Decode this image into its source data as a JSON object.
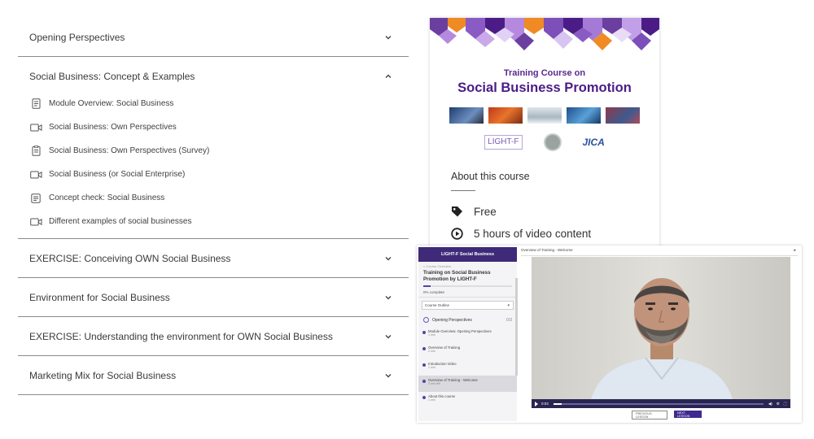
{
  "curriculum": {
    "sections": [
      {
        "title": "Opening Perspectives",
        "expanded": false
      },
      {
        "title": "Social Business: Concept & Examples",
        "expanded": true,
        "lessons": [
          {
            "icon": "document-icon",
            "label": "Module Overview: Social Business"
          },
          {
            "icon": "video-icon",
            "label": "Social Business: Own Perspectives"
          },
          {
            "icon": "survey-icon",
            "label": "Social Business: Own Perspectives (Survey)"
          },
          {
            "icon": "video-icon",
            "label": "Social Business (or Social Enterprise)"
          },
          {
            "icon": "quiz-icon",
            "label": "Concept check: Social Business"
          },
          {
            "icon": "video-icon",
            "label": "Different examples of social businesses"
          }
        ]
      },
      {
        "title": "EXERCISE: Conceiving OWN Social Business",
        "expanded": false
      },
      {
        "title": "Environment for Social Business",
        "expanded": false
      },
      {
        "title": "EXERCISE: Understanding the environment for OWN Social Business",
        "expanded": false
      },
      {
        "title": "Marketing Mix for Social Business",
        "expanded": false
      }
    ]
  },
  "course_card": {
    "subtitle": "Training Course on",
    "title": "Social Business Promotion",
    "logos": {
      "light_f": "LIGHT-F",
      "jica": "JICA"
    },
    "about_heading": "About this course",
    "features": [
      {
        "icon": "tag-icon",
        "label": "Free"
      },
      {
        "icon": "play-circle-icon",
        "label": "5 hours of video content"
      }
    ],
    "colors": {
      "brand_purple": "#4b1c86",
      "accent_orange": "#f08a24"
    }
  },
  "player": {
    "sidebar_header": "LIGHT-F Social Business",
    "breadcrumb": "< Course Overview",
    "course_title": "Training on Social Business Promotion by LIGHT-F",
    "progress_text": "0% complete",
    "progress_fraction": 0.08,
    "dropdown_value": "Course Outline",
    "module_title": "Opening Perspectives",
    "module_meta": "0/3",
    "items": [
      {
        "title": "Module Overview: Opening Perspectives",
        "meta": "1 min"
      },
      {
        "title": "Overview of Training",
        "meta": "2 min"
      },
      {
        "title": "Introduction Video",
        "meta": "1 min"
      },
      {
        "title": "Overview of Training - Welcome",
        "meta": "3 min left",
        "active": true
      },
      {
        "title": "About this course",
        "meta": "1 min"
      }
    ],
    "video_title": "Overview of Training - Welcome",
    "time": "0:03",
    "video_progress": 0.04,
    "prev_label": "PREVIOUS LESSON",
    "next_label": "NEXT LESSON"
  }
}
